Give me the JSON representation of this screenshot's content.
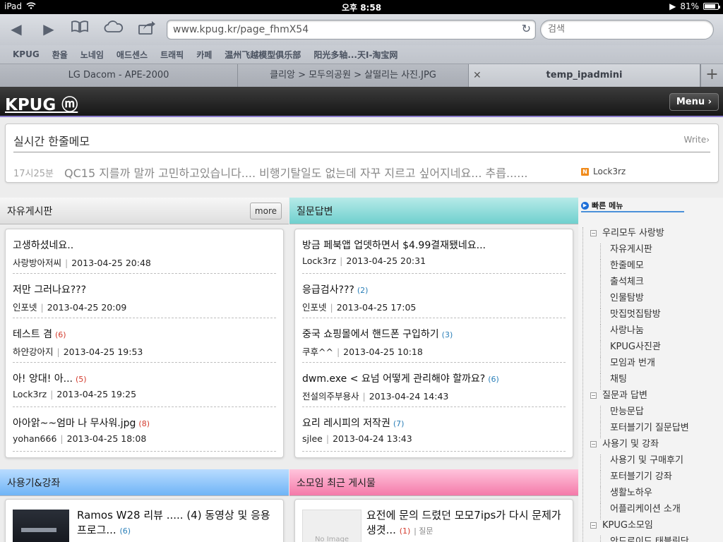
{
  "status": {
    "device": "iPad",
    "time": "오후 8:58",
    "battery": "81%"
  },
  "toolbar": {
    "url": "www.kpug.kr/page_fhmX54",
    "search_placeholder": "검색"
  },
  "bookmarks": [
    "KPUG",
    "환율",
    "노네임",
    "애드센스",
    "트래픽",
    "카페",
    "温州飞越模型俱乐部",
    "阳光多轴...天I-淘宝网"
  ],
  "tabs": [
    {
      "label": "LG Dacom - APE-2000",
      "active": false
    },
    {
      "label": "클리앙 > 모두의공원 > 살떨리는 사진.JPG",
      "active": false
    },
    {
      "label": "temp_ipadmini",
      "active": true
    }
  ],
  "site": {
    "logo": "KPUG ⓜ",
    "menu_label": "Menu ›"
  },
  "memo": {
    "title": "실시간 한줄메모",
    "write_label": "Write›",
    "time": "17시25분",
    "text": "QC15 지를까 말까 고민하고있습니다.... 비행기탈일도 없는데 자꾸 지르고 싶어지네요... 추릅......",
    "user_icon": "N",
    "user": "Lock3rz"
  },
  "free_board": {
    "title": "자유게시판",
    "more_label": "more",
    "posts": [
      {
        "title": "고생하셨네요..",
        "count": "",
        "author": "사랑방아저씨",
        "date": "2013-04-25 20:48"
      },
      {
        "title": "저만 그러나요???",
        "count": "",
        "author": "인포넷",
        "date": "2013-04-25 20:09"
      },
      {
        "title": "테스트 겸",
        "count": "(6)",
        "author": "하얀강아지",
        "date": "2013-04-25 19:53"
      },
      {
        "title": "아! 앙대! 아...",
        "count": "(5)",
        "author": "Lock3rz",
        "date": "2013-04-25 19:25"
      },
      {
        "title": "아아앍~~엄마 나 무사워.jpg",
        "count": "(8)",
        "author": "yohan666",
        "date": "2013-04-25 18:08"
      }
    ]
  },
  "qna_board": {
    "title": "질문답변",
    "posts": [
      {
        "title": "방금 페북앱 업뎃하면서 $4.99결재됐네요...",
        "count": "",
        "author": "Lock3rz",
        "date": "2013-04-25 20:31"
      },
      {
        "title": "응급검사???",
        "count": "(2)",
        "author": "인포넷",
        "date": "2013-04-25 17:05"
      },
      {
        "title": "중국 쇼핑몰에서 핸드폰 구입하기",
        "count": "(3)",
        "author": "쿠후^^",
        "date": "2013-04-25 10:18"
      },
      {
        "title": "dwm.exe < 요넘 어떻게 관리해야 할까요?",
        "count": "(6)",
        "author": "전설의주부용사",
        "date": "2013-04-24 14:43"
      },
      {
        "title": "요리 레시피의 저작권",
        "count": "(7)",
        "author": "sjlee",
        "date": "2013-04-24 13:43"
      }
    ]
  },
  "review_board": {
    "title": "사용기&강좌",
    "post_title": "Ramos W28 리뷰 ..... (4) 동영상 및 응용 프로그...",
    "post_count": "(6)"
  },
  "group_board": {
    "title": "소모임 최근 게시물",
    "thumb_label": "No Image",
    "post_title": "요전에 문의 드렸던 모모7ips가 다시 문제가 생겻...",
    "post_count": "(1)",
    "post_category": "질문"
  },
  "quick_menu": {
    "title": "빠른 메뉴",
    "items": [
      {
        "label": "우리모두 사랑방",
        "type": "cat"
      },
      {
        "label": "자유게시판",
        "type": "sub"
      },
      {
        "label": "한줄메모",
        "type": "sub"
      },
      {
        "label": "출석체크",
        "type": "sub"
      },
      {
        "label": "인물탐방",
        "type": "sub"
      },
      {
        "label": "맛집멋집탐방",
        "type": "sub"
      },
      {
        "label": "사랑나눔",
        "type": "sub"
      },
      {
        "label": "KPUG사진관",
        "type": "sub"
      },
      {
        "label": "모임과 번개",
        "type": "sub"
      },
      {
        "label": "채팅",
        "type": "sub"
      },
      {
        "label": "질문과 답변",
        "type": "cat"
      },
      {
        "label": "만능문답",
        "type": "sub"
      },
      {
        "label": "포터블기기 질문답변",
        "type": "sub"
      },
      {
        "label": "사용기 및 강좌",
        "type": "cat"
      },
      {
        "label": "사용기 및 구매후기",
        "type": "sub"
      },
      {
        "label": "포터블기기 강좌",
        "type": "sub"
      },
      {
        "label": "생활노하우",
        "type": "sub"
      },
      {
        "label": "어플리케이션 소개",
        "type": "sub"
      },
      {
        "label": "KPUG소모임",
        "type": "cat"
      },
      {
        "label": "안드로이드 태블릿단",
        "type": "sub"
      }
    ]
  },
  "colors": {
    "count_red": "#d33a2c",
    "count_blue": "#2a7fb8",
    "header_accent": "#8a7ccc"
  }
}
